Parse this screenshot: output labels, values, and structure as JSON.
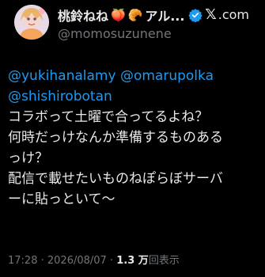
{
  "header": {
    "display_name": "桃鈴ねね",
    "name_suffix": "アル...",
    "handle": "@momosuzunene",
    "emoji": [
      "🍑",
      "🥐"
    ],
    "brand_text": ".com",
    "icons": {
      "verified": "verified-badge-icon",
      "brand": "x-logo-icon"
    },
    "colors": {
      "verified": "#1d9bf0",
      "mention": "#1d9bf0",
      "muted": "#71767b",
      "text": "#e7e9ea",
      "background": "#000000"
    }
  },
  "tweet": {
    "mentions": [
      "@yukihanalamy",
      "@omarupolka",
      "@shishirobotan"
    ],
    "lines": [
      "コラボって土曜で合ってるよね？",
      "何時だっけなんか準備するものある",
      "っけ？",
      "配信で載せたいものねぽらぼサーバ",
      "ーに貼っといて〜"
    ]
  },
  "meta": {
    "time": "17:28",
    "date": "2026/08/07",
    "separator": "·",
    "views_count": "1.3 万",
    "views_label": "回表示"
  }
}
